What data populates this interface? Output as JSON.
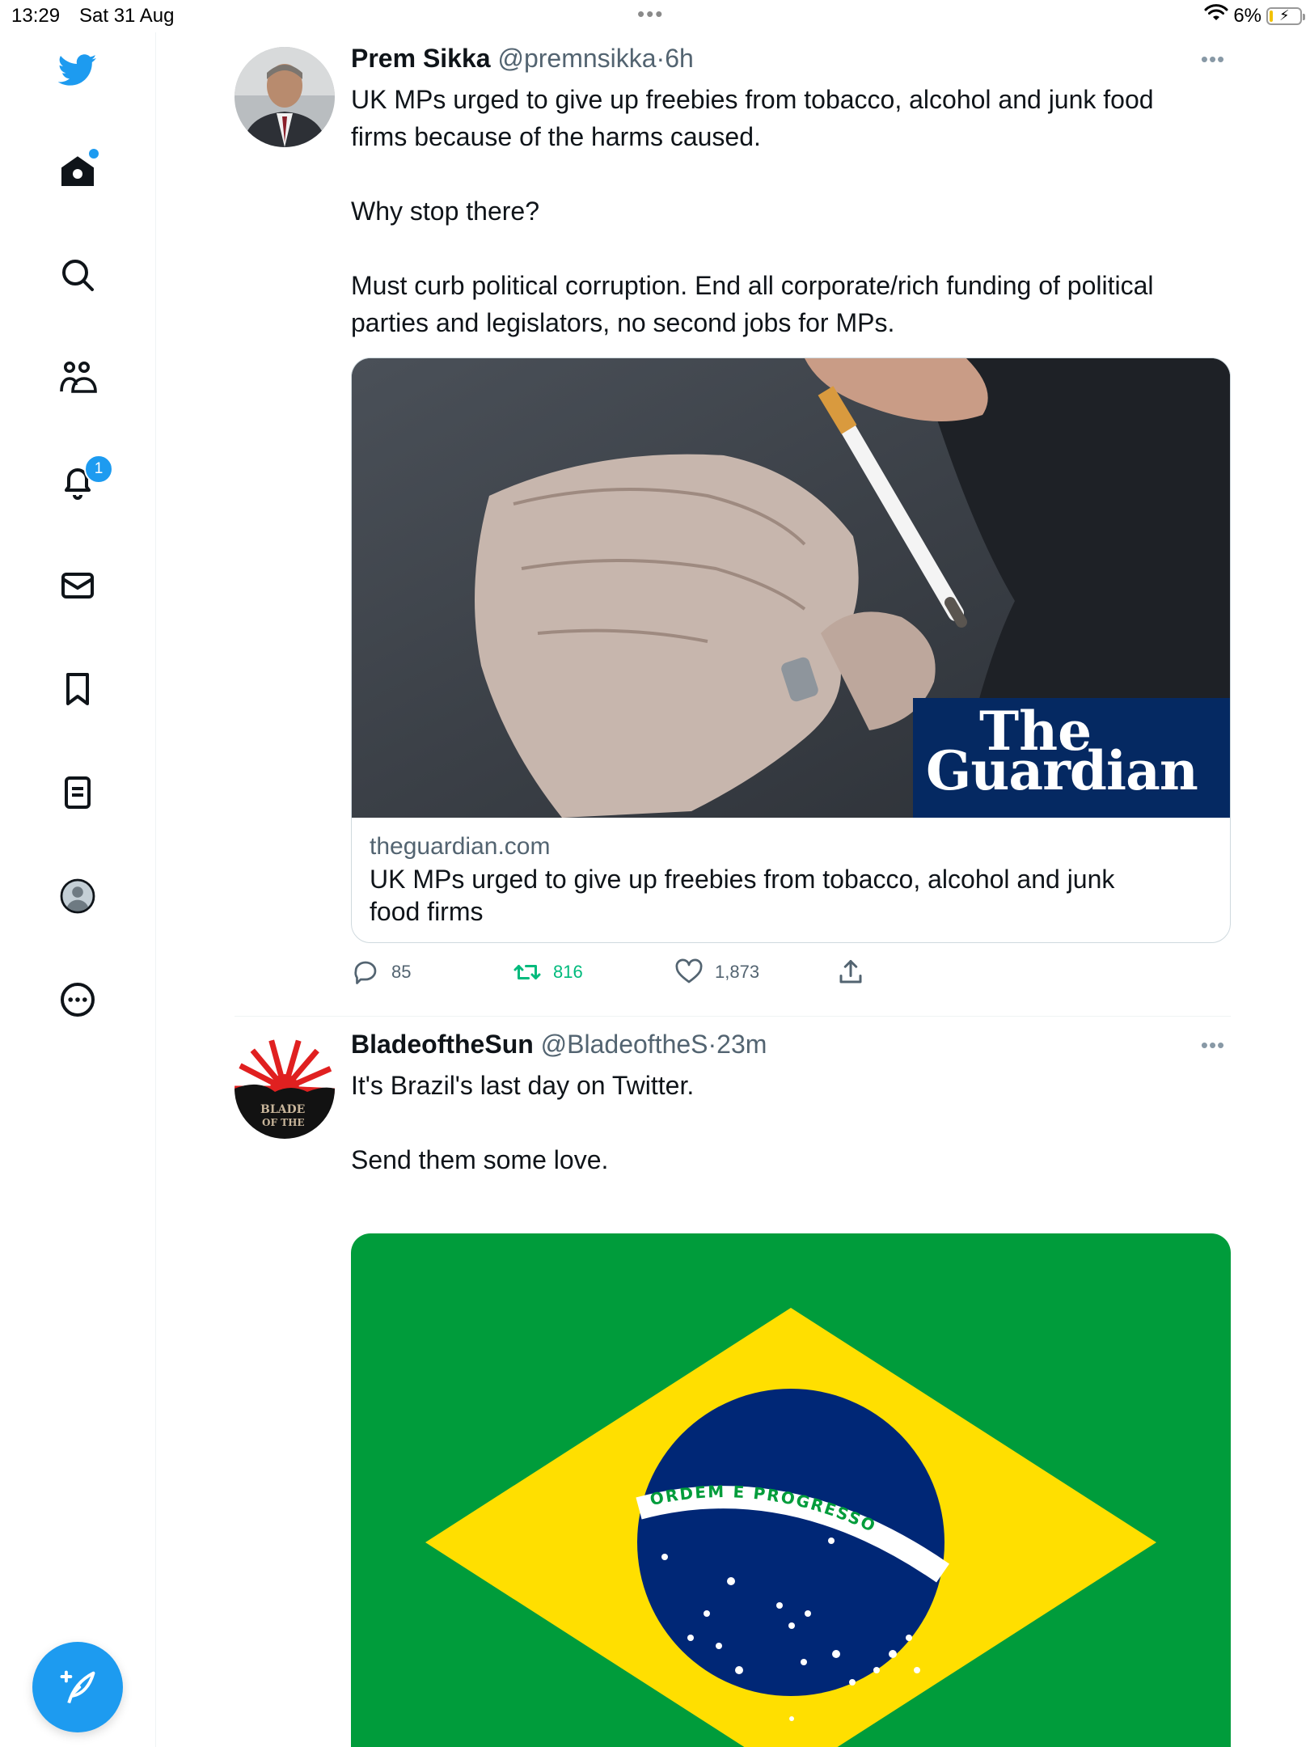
{
  "status_bar": {
    "time": "13:29",
    "date": "Sat 31 Aug",
    "multitask_dots": "•••",
    "battery": "6%"
  },
  "sidebar": {
    "items": [
      {
        "icon": "twitter-logo-icon"
      },
      {
        "icon": "home-icon"
      },
      {
        "icon": "search-icon"
      },
      {
        "icon": "communities-icon"
      },
      {
        "icon": "notifications-icon",
        "badge": "1"
      },
      {
        "icon": "messages-icon"
      },
      {
        "icon": "bookmarks-icon"
      },
      {
        "icon": "lists-icon"
      },
      {
        "icon": "profile-icon"
      },
      {
        "icon": "more-icon"
      }
    ],
    "compose_icon": "compose-icon"
  },
  "colors": {
    "accent": "#1d9bf0",
    "retweet_green": "#00ba7c",
    "text_primary": "#0f1419",
    "text_secondary": "#536471",
    "guardian_blue": "#052962",
    "brazil_green": "#009c3b",
    "brazil_yellow": "#ffdf00",
    "brazil_blue": "#002776"
  },
  "tweets": [
    {
      "name": "Prem Sikka",
      "handle": "@premnsikka",
      "separator": "·",
      "time": "6h",
      "text": "UK MPs urged to give up freebies from tobacco, alcohol and junk food\nfirms because of the harms caused.\n\nWhy stop there?\n\nMust curb political corruption. End all corporate/rich funding of political\nparties and legislators, no second jobs for MPs.",
      "card": {
        "logo_line1": "The",
        "logo_line2": "Guardian",
        "domain": "theguardian.com",
        "title": "UK MPs urged to give up freebies from tobacco, alcohol and junk\nfood firms"
      },
      "stats": {
        "replies": "85",
        "retweets": "816",
        "likes": "1,873"
      }
    },
    {
      "name": "BladeoftheSun",
      "handle": "@BladeoftheS",
      "separator": "·",
      "time": "23m",
      "avatar_text": "BLADE\nOF THE",
      "text": "It's Brazil's last day on Twitter.\n\nSend them some love.",
      "flag_motto": "ORDEM E PROGRESSO"
    }
  ]
}
